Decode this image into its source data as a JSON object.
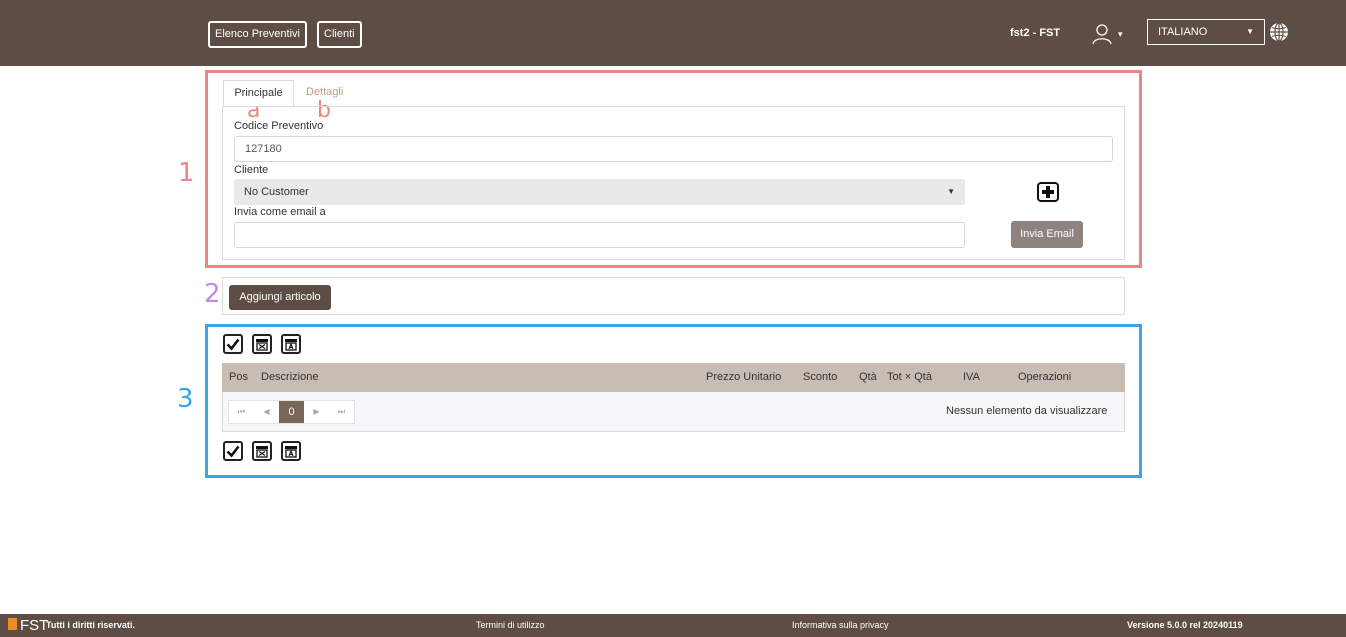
{
  "header": {
    "nav": [
      "Elenco Preventivi",
      "Clienti"
    ],
    "user": "fst2 - FST",
    "language": "ITALIANO"
  },
  "annotations": {
    "numbers": [
      "1",
      "2",
      "3"
    ],
    "letters": [
      "a",
      "b"
    ]
  },
  "tabs": {
    "active": "Principale",
    "inactive": "Dettagli"
  },
  "form": {
    "code_label": "Codice Preventivo",
    "code_value": "127180",
    "customer_label": "Cliente",
    "customer_value": "No Customer",
    "email_label": "Invia come email a",
    "email_value": "",
    "send_email_button": "Invia Email"
  },
  "add_item_button": "Aggiungi articolo",
  "table": {
    "columns": [
      "Pos",
      "Descrizione",
      "Prezzo Unitario",
      "Sconto",
      "Qtà",
      "Tot × Qtà",
      "IVA",
      "Operazioni"
    ],
    "page": "0",
    "empty_message": "Nessun elemento da visualizzare"
  },
  "footer": {
    "brand": "FST",
    "rights": "Tutti i diritti riservati.",
    "terms": "Termini di utilizzo",
    "privacy": "Informativa sulla privacy",
    "version": "Versione 5.0.0 rel 20240119"
  },
  "colors": {
    "brand": "#5d4d45",
    "annotation_red": "#ec8489",
    "annotation_blue": "#3aa6e8",
    "annotation_purple": "#c08ae6"
  }
}
